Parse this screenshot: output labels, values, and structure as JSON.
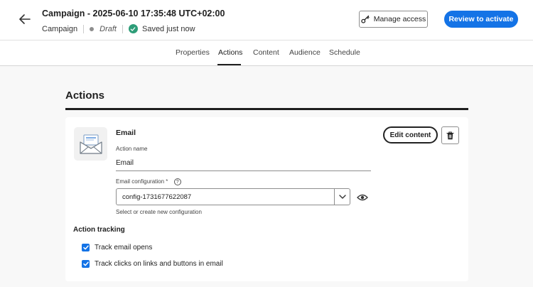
{
  "header": {
    "back_icon": "arrow-left-icon",
    "title": "Campaign - 2025-06-10 17:35:48 UTC+02:00",
    "type_label": "Campaign",
    "status_label": "Draft",
    "saved_label": "Saved just now",
    "saved_icon": "check-circle-icon",
    "manage_access_label": "Manage access",
    "manage_access_icon": "key-icon",
    "review_label": "Review to activate",
    "accent_color": "#1473e6",
    "saved_color": "#2d9d78"
  },
  "tabs": [
    {
      "label": "Properties",
      "active": false
    },
    {
      "label": "Actions",
      "active": true
    },
    {
      "label": "Content",
      "active": false
    },
    {
      "label": "Audience",
      "active": false
    },
    {
      "label": "Schedule",
      "active": false
    }
  ],
  "section": {
    "title": "Actions"
  },
  "card": {
    "icon": "email-envelope-icon",
    "name": "Email",
    "action_name_label": "Action name",
    "action_name_value": "Email",
    "email_config_label": "Email configuration",
    "required_marker": "*",
    "help_icon": "help-circle-icon",
    "email_config_value": "config-1731677622087",
    "email_config_hint": "Select or create new configuration",
    "preview_icon": "eye-icon",
    "edit_content_label": "Edit content",
    "delete_icon": "trash-icon"
  },
  "tracking": {
    "title": "Action tracking",
    "options": [
      {
        "label": "Track email opens",
        "checked": true
      },
      {
        "label": "Track clicks on links and buttons in email",
        "checked": true
      }
    ]
  }
}
